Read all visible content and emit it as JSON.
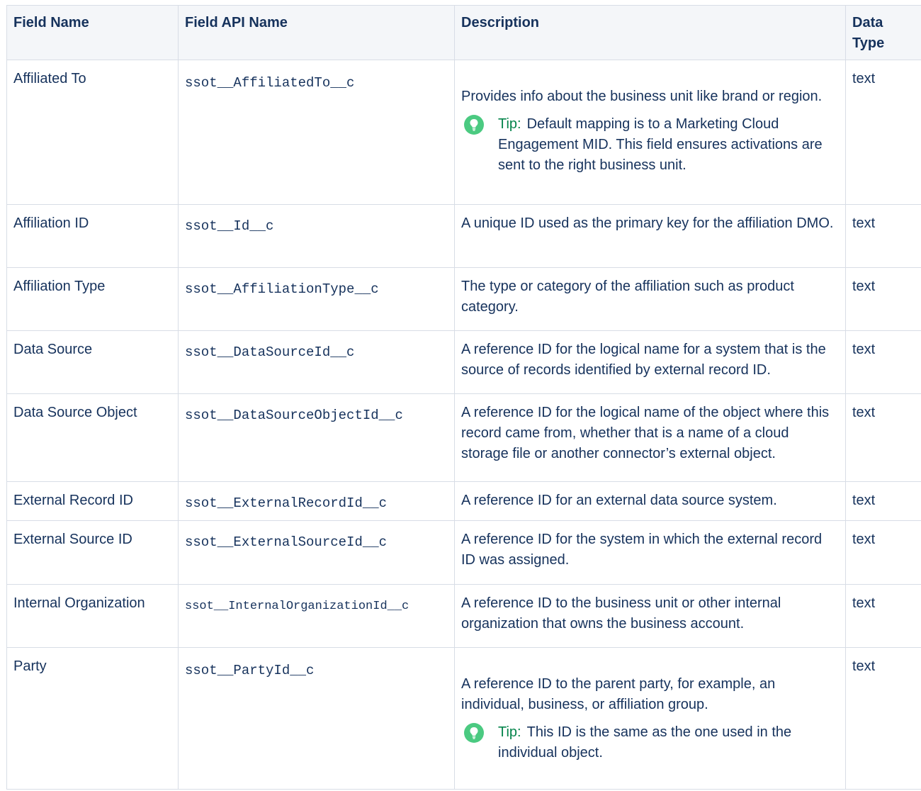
{
  "headers": {
    "field_name": "Field Name",
    "api_name": "Field API Name",
    "description": "Description",
    "data_type": "Data Type"
  },
  "tip_label": "Tip:",
  "colors": {
    "text": "#16325c",
    "border": "#d8dde6",
    "header_bg": "#f4f6f9",
    "tip_green": "#4bca81",
    "tip_label": "#04844b"
  },
  "rows": [
    {
      "field_name": "Affiliated To",
      "api_name": "ssot__AffiliatedTo__c",
      "description": "Provides info about the business unit like brand or region.",
      "tip": "Default mapping is to a Marketing Cloud Engagement MID. This field ensures activations are sent to the right business unit.",
      "data_type": "text"
    },
    {
      "field_name": "Affiliation ID",
      "api_name": "ssot__Id__c",
      "description": "A unique ID used as the primary key for the affiliation DMO.",
      "data_type": "text"
    },
    {
      "field_name": "Affiliation Type",
      "api_name": "ssot__AffiliationType__c",
      "description": "The type or category of the affiliation such as product category.",
      "data_type": "text"
    },
    {
      "field_name": "Data Source",
      "api_name": "ssot__DataSourceId__c",
      "description": "A reference ID for the logical name for a system that is the source of records identified by external record ID.",
      "data_type": "text"
    },
    {
      "field_name": "Data Source Object",
      "api_name": "ssot__DataSourceObjectId__c",
      "description": "A reference ID for the logical name of the object where this record came from, whether that is a name of a cloud storage file or another connector’s external object.",
      "data_type": "text"
    },
    {
      "field_name": "External Record ID",
      "api_name": "ssot__ExternalRecordId__c",
      "description": "A reference ID for an external data source system.",
      "data_type": "text"
    },
    {
      "field_name": "External Source ID",
      "api_name": "ssot__ExternalSourceId__c",
      "description": "A reference ID for the system in which the external record ID was assigned.",
      "data_type": "text"
    },
    {
      "field_name": "Internal Organization",
      "api_name": "ssot__InternalOrganizationId__c",
      "description": "A reference ID to the business unit or other internal organization that owns the business account.",
      "data_type": "text"
    },
    {
      "field_name": "Party",
      "api_name": "ssot__PartyId__c",
      "description": "A reference ID to the parent party, for example, an individual, business, or affiliation group.",
      "tip": "This ID is the same as the one used in the individual object.",
      "data_type": "text"
    }
  ]
}
